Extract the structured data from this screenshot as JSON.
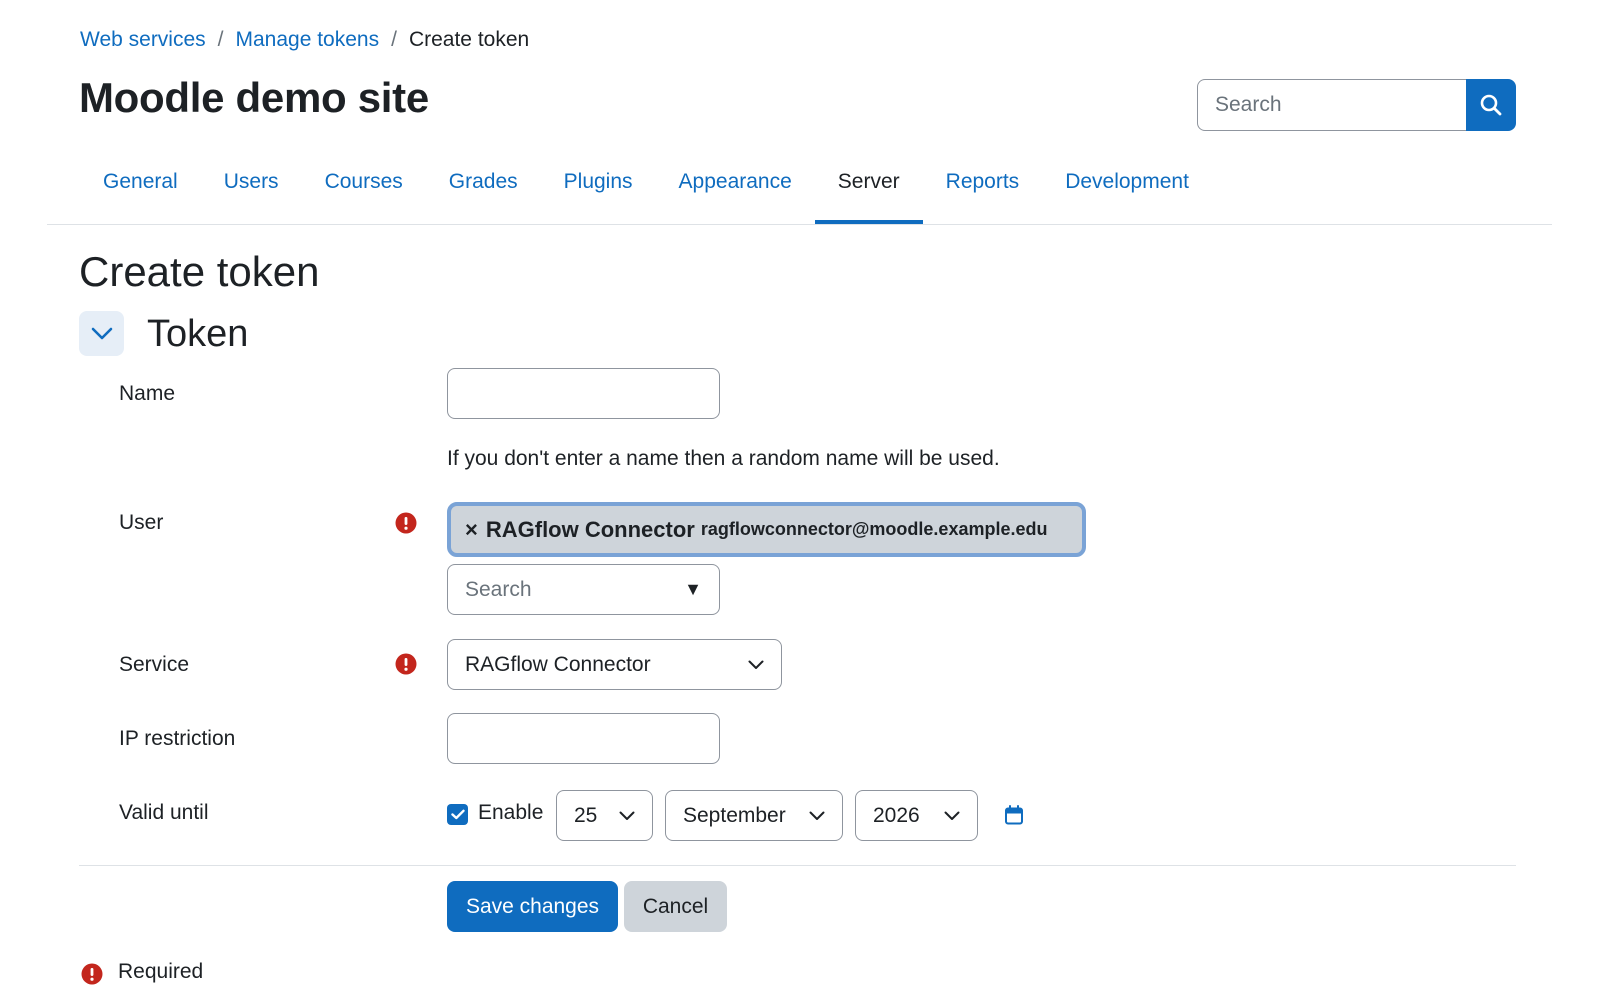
{
  "breadcrumb": {
    "items": [
      {
        "label": "Web services"
      },
      {
        "label": "Manage tokens"
      },
      {
        "label": "Create token"
      }
    ],
    "separator": "/"
  },
  "header": {
    "site_title": "Moodle demo site",
    "search_placeholder": "Search",
    "search_icon": "search-icon"
  },
  "nav_tabs": [
    {
      "label": "General",
      "active": false
    },
    {
      "label": "Users",
      "active": false
    },
    {
      "label": "Courses",
      "active": false
    },
    {
      "label": "Grades",
      "active": false
    },
    {
      "label": "Plugins",
      "active": false
    },
    {
      "label": "Appearance",
      "active": false
    },
    {
      "label": "Server",
      "active": true
    },
    {
      "label": "Reports",
      "active": false
    },
    {
      "label": "Development",
      "active": false
    }
  ],
  "page": {
    "heading": "Create token",
    "section_title": "Token"
  },
  "form": {
    "name": {
      "label": "Name",
      "value": "",
      "help": "If you don't enter a name then a random name will be used."
    },
    "user": {
      "label": "User",
      "required": true,
      "selected_chip": {
        "remove": "×",
        "name": "RAGflow Connector",
        "email": "ragflowconnector@moodle.example.edu"
      },
      "search_placeholder": "Search",
      "dropdown_arrow": "▼"
    },
    "service": {
      "label": "Service",
      "required": true,
      "value": "RAGflow Connector"
    },
    "ip_restriction": {
      "label": "IP restriction",
      "value": ""
    },
    "valid_until": {
      "label": "Valid until",
      "enable_label": "Enable",
      "enabled": true,
      "day": "25",
      "month": "September",
      "year": "2026",
      "calendar_icon": "calendar-icon"
    }
  },
  "actions": {
    "save_label": "Save changes",
    "cancel_label": "Cancel"
  },
  "footer": {
    "required_label": "Required"
  },
  "colors": {
    "primary": "#0f6cbf",
    "required": "#c3261d",
    "chip_bg": "#ced4da",
    "chip_border": "#7aa3d6"
  }
}
